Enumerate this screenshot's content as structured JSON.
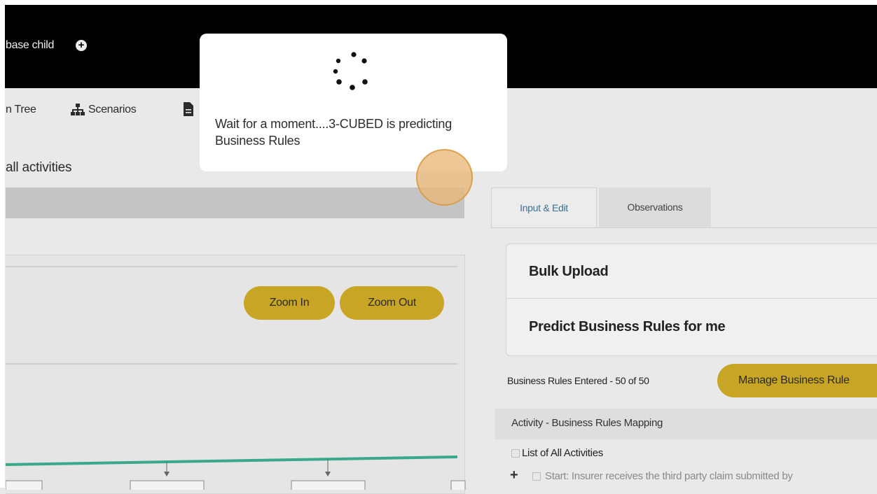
{
  "header": {
    "breadcrumb": "base child",
    "add_icon_glyph": "+"
  },
  "nav": {
    "tree_label": "n Tree",
    "scenarios_label": "Scenarios"
  },
  "left": {
    "section_title": "all activities",
    "zoom_in_label": "Zoom In",
    "zoom_out_label": "Zoom Out"
  },
  "modal": {
    "message": "Wait for a moment....3-CUBED is predicting Business Rules"
  },
  "right": {
    "tabs": [
      {
        "label": "Input & Edit",
        "active": true
      },
      {
        "label": "Observations",
        "active": false
      }
    ],
    "actions": {
      "bulk_upload": "Bulk Upload",
      "predict": "Predict Business Rules for me"
    },
    "rules_count": "Business Rules Entered - 50 of 50",
    "manage_button": "Manage Business Rule",
    "mapping_title": "Activity - Business Rules Mapping",
    "list_all": "List of All Activities",
    "expand_glyph": "+",
    "first_activity": "Start: Insurer receives the third party claim submitted by"
  },
  "colors": {
    "accent_gold": "#c8a524",
    "tree_teal": "#3aa88a",
    "tab_active_text": "#3d6f8d"
  },
  "icons": [
    "plus-circle-icon",
    "sitemap-icon",
    "document-icon",
    "loading-spinner-icon"
  ]
}
